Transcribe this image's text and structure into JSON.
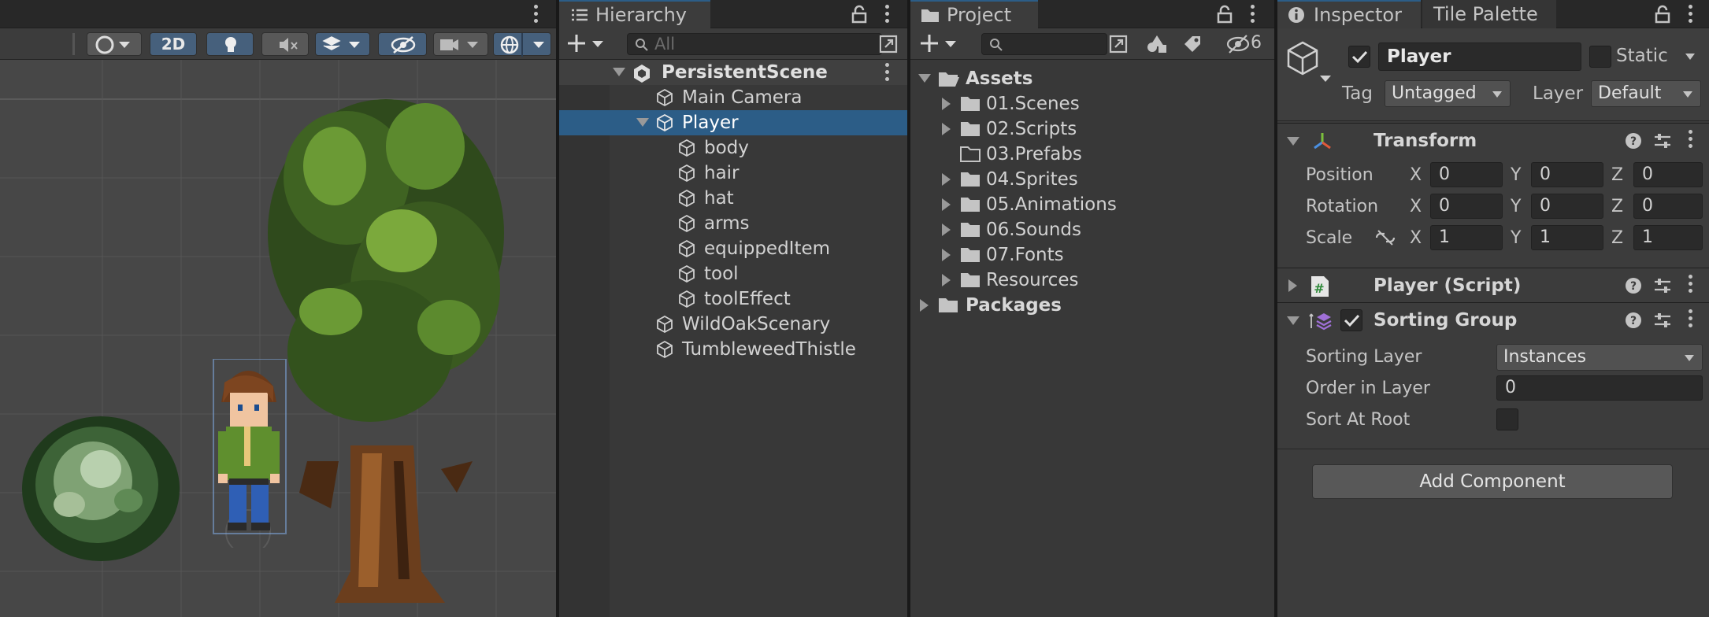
{
  "scene": {
    "toolbar": {
      "mode_2d_label": "2D"
    }
  },
  "hierarchy": {
    "tab_label": "Hierarchy",
    "search_placeholder": "All",
    "items": [
      {
        "label": "PersistentScene"
      },
      {
        "label": "Main Camera"
      },
      {
        "label": "Player"
      },
      {
        "label": "body"
      },
      {
        "label": "hair"
      },
      {
        "label": "hat"
      },
      {
        "label": "arms"
      },
      {
        "label": "equippedItem"
      },
      {
        "label": "tool"
      },
      {
        "label": "toolEffect"
      },
      {
        "label": "WildOakScenary"
      },
      {
        "label": "TumbleweedThistle"
      }
    ]
  },
  "project": {
    "tab_label": "Project",
    "hidden_count": "6",
    "items": [
      {
        "label": "Assets"
      },
      {
        "label": "01.Scenes"
      },
      {
        "label": "02.Scripts"
      },
      {
        "label": "03.Prefabs"
      },
      {
        "label": "04.Sprites"
      },
      {
        "label": "05.Animations"
      },
      {
        "label": "06.Sounds"
      },
      {
        "label": "07.Fonts"
      },
      {
        "label": "Resources"
      },
      {
        "label": "Packages"
      }
    ]
  },
  "inspector": {
    "tab_label": "Inspector",
    "tab2_label": "Tile Palette",
    "object_name": "Player",
    "static_label": "Static",
    "tag_label": "Tag",
    "tag_value": "Untagged",
    "layer_label": "Layer",
    "layer_value": "Default",
    "transform": {
      "title": "Transform",
      "position_label": "Position",
      "rotation_label": "Rotation",
      "scale_label": "Scale",
      "x": "X",
      "y": "Y",
      "z": "Z",
      "position": [
        "0",
        "0",
        "0"
      ],
      "rotation": [
        "0",
        "0",
        "0"
      ],
      "scale": [
        "1",
        "1",
        "1"
      ]
    },
    "script_component": {
      "title": "Player (Script)"
    },
    "sorting_group": {
      "title": "Sorting Group",
      "sorting_layer_label": "Sorting Layer",
      "sorting_layer_value": "Instances",
      "order_label": "Order in Layer",
      "order_value": "0",
      "sort_at_root_label": "Sort At Root"
    },
    "add_component_label": "Add Component"
  },
  "colors": {
    "selection": "#2c5d87",
    "panel": "#383838",
    "scene_bg": "#474747",
    "tree_dark": "#2f4a1c",
    "tree_light": "#7ba93c",
    "trunk": "#6b3e1d"
  }
}
